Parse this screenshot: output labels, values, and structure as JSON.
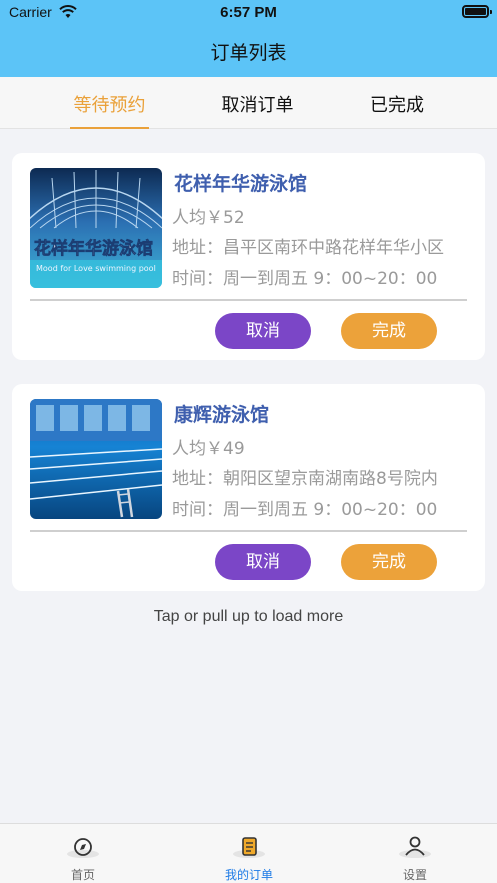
{
  "status_bar": {
    "carrier": "Carrier",
    "time": "6:57 PM"
  },
  "nav": {
    "title": "订单列表"
  },
  "tabs": [
    {
      "label": "等待预约",
      "active": true
    },
    {
      "label": "取消订单",
      "active": false
    },
    {
      "label": "已完成",
      "active": false
    }
  ],
  "orders": [
    {
      "name": "花样年华游泳馆",
      "price": "人均￥52",
      "address": "地址：昌平区南环中路花样年华小区",
      "hours": "时间：周一到周五 9：00~20：00",
      "cancel_label": "取消",
      "complete_label": "完成",
      "thumb_sign": "花样年华游泳馆",
      "thumb_sign_en": "Mood for Love swimming pool"
    },
    {
      "name": "康辉游泳馆",
      "price": "人均￥49",
      "address": "地址：朝阳区望京南湖南路8号院内",
      "hours": "时间：周一到周五 9：00~20：00",
      "cancel_label": "取消",
      "complete_label": "完成"
    }
  ],
  "load_more": "Tap or pull up to load more",
  "tabbar": [
    {
      "label": "首页",
      "icon": "compass-icon",
      "active": false
    },
    {
      "label": "我的订单",
      "icon": "order-icon",
      "active": true
    },
    {
      "label": "设置",
      "icon": "user-icon",
      "active": false
    }
  ],
  "colors": {
    "header": "#5cc4f7",
    "active_tab": "#eaa13a",
    "cancel_button": "#7b46c7",
    "complete_button": "#eca23a",
    "title_text": "#3f5fae",
    "tabbar_active": "#1e7be6"
  }
}
